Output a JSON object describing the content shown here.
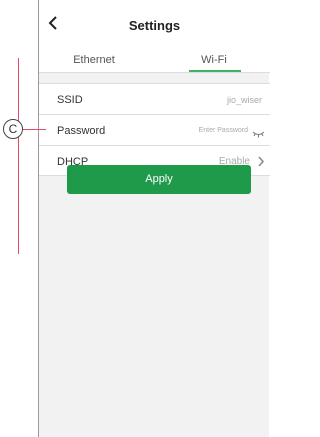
{
  "header": {
    "title": "Settings",
    "back_icon": "chevron-left-icon"
  },
  "tabs": [
    {
      "label": "Ethernet",
      "active": false
    },
    {
      "label": "Wi-Fi",
      "active": true
    }
  ],
  "fields": {
    "ssid": {
      "label": "SSID",
      "value": "jio_wiser"
    },
    "password": {
      "label": "Password",
      "placeholder": "Enter Password",
      "icon": "eye-hidden-icon"
    },
    "dhcp": {
      "label": "DHCP",
      "value": "Enable",
      "icon": "chevron-right-icon"
    }
  },
  "apply_label": "Apply",
  "annotation": {
    "marker": "C"
  },
  "colors": {
    "accent": "#1e9a4a",
    "tab_underline": "#3db363",
    "annotation_line": "#e34b6a"
  }
}
